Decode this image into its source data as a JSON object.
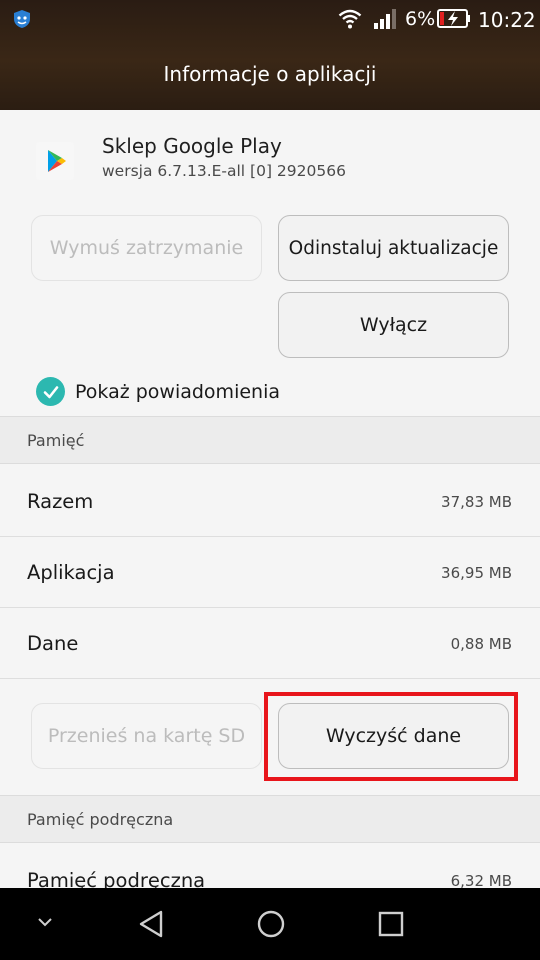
{
  "status_bar": {
    "battery_pct": "6%",
    "time": "10:22",
    "icons": [
      "vpn-shield-icon",
      "wifi-icon",
      "signal-icon",
      "battery-charging-icon"
    ]
  },
  "header": {
    "title": "Informacje o aplikacji"
  },
  "app": {
    "name": "Sklep Google Play",
    "version": "wersja 6.7.13.E-all [0] 2920566",
    "icon": "google-play-icon"
  },
  "actions": {
    "force_stop": "Wymuś zatrzymanie",
    "uninstall_updates": "Odinstaluj aktualizacje",
    "disable": "Wyłącz"
  },
  "notifications": {
    "label": "Pokaż powiadomienia",
    "checked": true
  },
  "storage": {
    "header": "Pamięć",
    "rows": [
      {
        "label": "Razem",
        "value": "37,83 MB"
      },
      {
        "label": "Aplikacja",
        "value": "36,95 MB"
      },
      {
        "label": "Dane",
        "value": "0,88 MB"
      }
    ],
    "move_to_sd": "Przenieś na kartę SD",
    "clear_data": "Wyczyść dane"
  },
  "cache": {
    "header": "Pamięć podręczna",
    "rows": [
      {
        "label": "Pamięć podręczna",
        "value": "6,32 MB"
      }
    ]
  },
  "colors": {
    "accent": "#2cb8b0",
    "highlight": "#e8151b",
    "header_bg": "#2f2015"
  },
  "nav_bar": {
    "icons": [
      "hide-nav-chevron-icon",
      "back-icon",
      "home-icon",
      "recents-icon"
    ]
  }
}
